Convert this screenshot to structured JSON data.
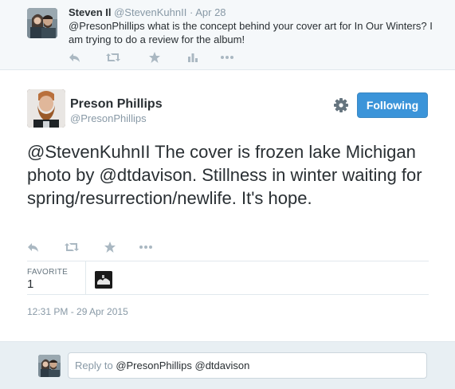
{
  "parent_tweet": {
    "author_name": "Steven Il",
    "author_handle": "@StevenKuhnII",
    "separator": "·",
    "time": "Apr 28",
    "mention": "@PresonPhillips",
    "text": " what is the concept behind your cover art for In Our Winters? I am trying to do a review for the album!",
    "actions": [
      "reply-icon",
      "retweet-icon",
      "favorite-icon",
      "stats-icon",
      "more-icon"
    ]
  },
  "main_tweet": {
    "author_name": "Preson Phillips",
    "author_handle": "@PresonPhillips",
    "follow_label": "Following",
    "text_parts": {
      "mention1": "@StevenKuhnII",
      "text1": " The cover is frozen lake Michigan photo by ",
      "mention2": "@dtdavison",
      "text2": ". Stillness in winter waiting for spring/resurrection/newlife. It's hope."
    },
    "actions": [
      "reply-icon",
      "retweet-icon",
      "favorite-icon",
      "more-icon"
    ],
    "stats": {
      "favorite_label": "FAVORITE",
      "favorite_count": "1"
    },
    "timestamp": "12:31 PM - 29 Apr 2015"
  },
  "reply": {
    "prefix": "Reply to ",
    "mentions": "@PresonPhillips @dtdavison"
  },
  "colors": {
    "follow_button": "#3b94d9",
    "muted_text": "#8899a6",
    "body_text": "#292f33",
    "parent_bg": "#f5f8fa",
    "reply_bg": "#e8eff3"
  }
}
